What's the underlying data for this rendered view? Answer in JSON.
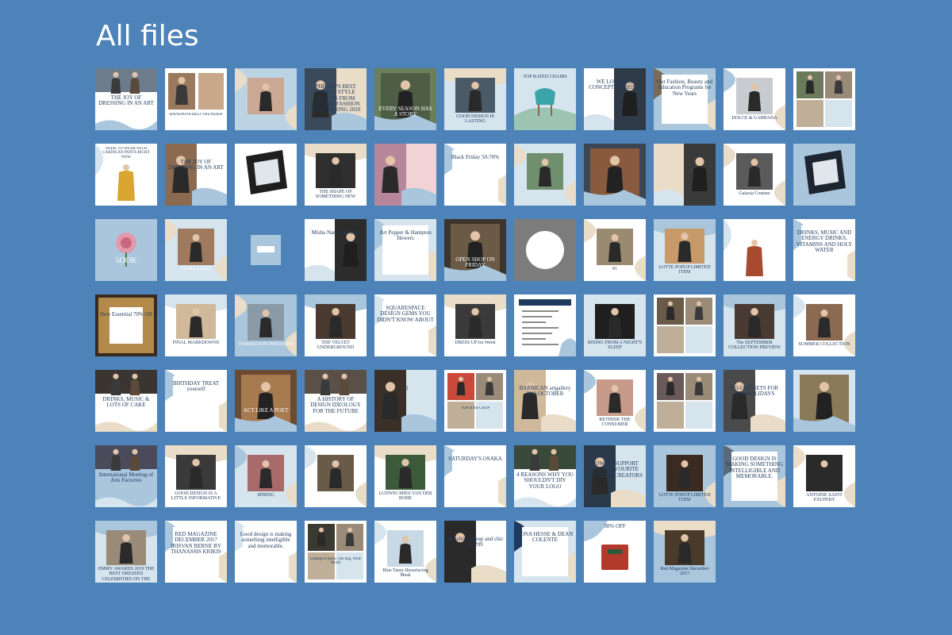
{
  "title": "All files",
  "colors": {
    "background": "#4d83b9",
    "navy": "#1f3a5c",
    "light_blue": "#a9c6dd",
    "pale_blue": "#d6e4ee",
    "beige": "#e9ddc8",
    "brown": "#8a6a4f",
    "gray": "#8c8c8c",
    "white": "#ffffff"
  },
  "tiles": [
    {
      "text": "THE JOY OF DRESSING IN AN ART",
      "bg": "#ffffff",
      "photo": "#6d7c8c",
      "layout": "top",
      "color": "#1f3a5c"
    },
    {
      "text": "BANDANA RED THUNDER",
      "bg": "#ffffff",
      "photo": "#9a7a5e",
      "layout": "split",
      "color": "#1f3a5c"
    },
    {
      "text": "",
      "bg": "#bcd3e4",
      "photo": "#caa893",
      "layout": "center",
      "color": "#1f3a5c"
    },
    {
      "text": "PHILOSPS BEST STREET STYLE PHOTOS FROM LONDON FASHION WEEK SPRING 2020",
      "bg": "#e9ddc8",
      "photo": "#3a4a5a",
      "layout": "left",
      "color": "#1f3a5c"
    },
    {
      "text": "EVERY SEASON HAS A STORY",
      "bg": "#6b7f5a",
      "photo": "#4e5e44",
      "layout": "full",
      "color": "#ffffff"
    },
    {
      "text": "GOOD DESIGN IS LASTING",
      "bg": "#d6e4ee",
      "photo": "#4a5a66",
      "layout": "bottom",
      "color": "#1f3a5c"
    },
    {
      "text": "TOP RATED CHAIRS",
      "bg": "#d6e4ee",
      "photo": "#3ba4a8",
      "layout": "chair",
      "color": "#1f3a5c"
    },
    {
      "text": "WE LOVE THE CONCEPT OF BEING",
      "bg": "#ffffff",
      "photo": "#2e3a46",
      "layout": "right",
      "color": "#1f3a5c"
    },
    {
      "text": "Our Fashion, Beauty and Education Programs for New Years",
      "bg": "#a9c6dd",
      "photo": "#7b6a58",
      "layout": "text",
      "color": "#1f3a5c"
    },
    {
      "text": "DOLCE & GABBANA",
      "bg": "#ffffff",
      "photo": "#c8ccd0",
      "layout": "center",
      "color": "#1f3a5c"
    },
    {
      "text": "",
      "bg": "#ffffff",
      "photo": "#6a7a5a",
      "layout": "grid",
      "color": "#1f3a5c"
    },
    {
      "text": "WHAT TO WEAR WITH CARDIGAN PANTS RIGHT NOW",
      "bg": "#ffffff",
      "photo": "#d8a530",
      "layout": "coat",
      "color": "#1f3a5c"
    },
    {
      "text": "THE JOY OF DRESSING IN AN ART",
      "bg": "#ffffff",
      "photo": "#8b6a50",
      "layout": "left",
      "color": "#1f3a5c"
    },
    {
      "text": "",
      "bg": "#ffffff",
      "photo": "#1e1e1e",
      "layout": "device",
      "color": "#1f3a5c"
    },
    {
      "text": "THE SHAPE OF SOMETHING NEW",
      "bg": "#ffffff",
      "photo": "#2f2f2f",
      "layout": "bottom",
      "color": "#1f3a5c"
    },
    {
      "text": "",
      "bg": "#f1d3d6",
      "photo": "#b7869a",
      "layout": "left",
      "color": "#1f3a5c"
    },
    {
      "text": "Black Friday 50-70%",
      "bg": "#ffffff",
      "photo": "#a9c6dd",
      "layout": "text",
      "color": "#1f3a5c"
    },
    {
      "text": "",
      "bg": "#d6e4ee",
      "photo": "#6f8f6e",
      "layout": "center",
      "color": "#1f3a5c"
    },
    {
      "text": "",
      "bg": "#3c4652",
      "photo": "#8a5a3e",
      "layout": "full",
      "color": "#ffffff"
    },
    {
      "text": "",
      "bg": "#e9ddc8",
      "photo": "#3a3a3a",
      "layout": "right",
      "color": "#1f3a5c"
    },
    {
      "text": "Galaxia Couture",
      "bg": "#ffffff",
      "photo": "#5a5a5a",
      "layout": "center",
      "color": "#1f3a5c"
    },
    {
      "text": "",
      "bg": "#a9c6dd",
      "photo": "#1d2530",
      "layout": "device",
      "color": "#1f3a5c"
    },
    {
      "text": "5OOK",
      "bg": "#a9c6dd",
      "photo": "#e29aac",
      "layout": "rose",
      "color": "#ffffff"
    },
    {
      "text": "ULTRA LIGHT",
      "bg": "#d6e4ee",
      "photo": "#a07a5e",
      "layout": "center",
      "color": "#ffffff"
    },
    {
      "text": "",
      "bg": "transparent",
      "photo": "#a9c6dd",
      "layout": "mini",
      "color": "#1f3a5c"
    },
    {
      "text": "Misha Nanov & Aldo",
      "bg": "#ffffff",
      "photo": "#2c2c2c",
      "layout": "right",
      "color": "#1f3a5c"
    },
    {
      "text": "Art Pepper & Hampton Hewers",
      "bg": "#d6e4ee",
      "photo": "#a9c6dd",
      "layout": "text",
      "color": "#1f3a5c"
    },
    {
      "text": "OPEN SHOP ON FRIDAY",
      "bg": "#3d352b",
      "photo": "#6a5a46",
      "layout": "full",
      "color": "#ffffff"
    },
    {
      "text": "",
      "bg": "#bdbdbd",
      "photo": "#7c7c7c",
      "layout": "circle",
      "color": "#1f3a5c"
    },
    {
      "text": "#1",
      "bg": "#ffffff",
      "photo": "#9a8a70",
      "layout": "center",
      "color": "#1f3a5c"
    },
    {
      "text": "LOTTE POPUP LIMITED ITEM",
      "bg": "#d6e4ee",
      "photo": "#c89a6a",
      "layout": "bottom",
      "color": "#1f3a5c"
    },
    {
      "text": "",
      "bg": "#ffffff",
      "photo": "#a84a30",
      "layout": "coat",
      "color": "#1f3a5c"
    },
    {
      "text": "DRINKS, MUSIC AND ENERGY DRINKS, VITAMINS AND HOLY WATER",
      "bg": "#ffffff",
      "photo": "#a9c6dd",
      "layout": "text",
      "color": "#1f3a5c"
    },
    {
      "text": "New Essential 70% Off",
      "bg": "#3a2a1c",
      "photo": "#b38a4a",
      "layout": "sale",
      "color": "#1f3a5c"
    },
    {
      "text": "FINAL MARKDOWNS",
      "bg": "#ffffff",
      "photo": "#d0b89a",
      "layout": "bottom",
      "color": "#1f3a5c"
    },
    {
      "text": "INSPIRATION IMITATION",
      "bg": "#a9c6dd",
      "photo": "#8a9aa6",
      "layout": "center",
      "color": "#ffffff"
    },
    {
      "text": "THE VELVET UNDERGROUND",
      "bg": "#ffffff",
      "photo": "#4a3a30",
      "layout": "bottom",
      "color": "#1f3a5c"
    },
    {
      "text": "SQUARESPACE DESIGN GEMS YOU DIDN'T KNOW ABOUT",
      "bg": "#ffffff",
      "photo": "#d6e4ee",
      "layout": "text",
      "color": "#1f3a5c"
    },
    {
      "text": "DRESS UP for Week",
      "bg": "#ffffff",
      "photo": "#3a3a3a",
      "layout": "bottom",
      "color": "#1f3a5c"
    },
    {
      "text": "",
      "bg": "#ffffff",
      "photo": "#1f3a5c",
      "layout": "list",
      "color": "#1f3a5c"
    },
    {
      "text": "RISING FROM A NIGHT'S SLEEP",
      "bg": "#d6e4ee",
      "photo": "#1f1f1f",
      "layout": "bottom",
      "color": "#1f3a5c"
    },
    {
      "text": "",
      "bg": "#ffffff",
      "photo": "#6a5a48",
      "layout": "grid",
      "color": "#1f3a5c"
    },
    {
      "text": "The SEPTEMBER COLLECTION PREVIEW",
      "bg": "#d6e4ee",
      "photo": "#4a3a34",
      "layout": "bottom",
      "color": "#1f3a5c"
    },
    {
      "text": "SUMMER COLLECTION",
      "bg": "#ffffff",
      "photo": "#8a6a50",
      "layout": "center",
      "color": "#1f3a5c"
    },
    {
      "text": "DRINKS, MUSIC & LOTS OF CAKE",
      "bg": "#ffffff",
      "photo": "#3a3530",
      "layout": "top",
      "color": "#1f3a5c"
    },
    {
      "text": "BIRTHDAY TREAT yourself",
      "bg": "#ffffff",
      "photo": "#a9c6dd",
      "layout": "text",
      "color": "#1f3a5c"
    },
    {
      "text": "ACT LIKE A POET",
      "bg": "#6a4a30",
      "photo": "#a87a50",
      "layout": "full",
      "color": "#ffffff"
    },
    {
      "text": "A HISTORY OF DESIGN IDEOLOGY FOR THE FUTURE",
      "bg": "#ffffff",
      "photo": "#5a5048",
      "layout": "top",
      "color": "#1f3a5c"
    },
    {
      "text": "12",
      "bg": "#d6e4ee",
      "photo": "#3a3028",
      "layout": "left",
      "color": "#1f3a5c"
    },
    {
      "text": "TOP of the CROP",
      "bg": "#ffffff",
      "photo": "#c94a3a",
      "layout": "grid",
      "color": "#1f3a5c"
    },
    {
      "text": "BARBICAN artgallery 20th OCTOBER",
      "bg": "#ffffff",
      "photo": "#d0b89a",
      "layout": "left",
      "color": "#1f3a5c"
    },
    {
      "text": "RETHINK THE CONSUMER",
      "bg": "#ffffff",
      "photo": "#c89a8a",
      "layout": "center",
      "color": "#1f3a5c"
    },
    {
      "text": "",
      "bg": "#ffffff",
      "photo": "#6a5a5a",
      "layout": "grid",
      "color": "#1f3a5c"
    },
    {
      "text": "CO-ORD SETS FOR THE HOLIDAYS",
      "bg": "#ffffff",
      "photo": "#4a4a4a",
      "layout": "left",
      "color": "#1f3a5c"
    },
    {
      "text": "",
      "bg": "#d6e4ee",
      "photo": "#8a7a5a",
      "layout": "full",
      "color": "#1f3a5c"
    },
    {
      "text": "International Meeting of Arts Factories",
      "bg": "#a9c6dd",
      "photo": "#4a4a5a",
      "layout": "top",
      "color": "#1f3a5c"
    },
    {
      "text": "GOOD DESIGN IS A LITTLE INFORMATIVE",
      "bg": "#ffffff",
      "photo": "#3a3a3a",
      "layout": "bottom",
      "color": "#1f3a5c"
    },
    {
      "text": "SPRING",
      "bg": "#d6e4ee",
      "photo": "#a86a6a",
      "layout": "center",
      "color": "#1f3a5c"
    },
    {
      "text": "",
      "bg": "#ffffff",
      "photo": "#6a5a48",
      "layout": "center",
      "color": "#1f3a5c"
    },
    {
      "text": "LUDWIG MIES VAN DER ROHE",
      "bg": "#ffffff",
      "photo": "#3a5a3a",
      "layout": "bottom",
      "color": "#1f3a5c"
    },
    {
      "text": "SATURDAY'S OSAKA",
      "bg": "#ffffff",
      "photo": "#a9c6dd",
      "layout": "text",
      "color": "#1f3a5c"
    },
    {
      "text": "4 REASONS WHY YOU SHOULDN'T DIY YOUR LOGO",
      "bg": "#ffffff",
      "photo": "#3a4a3a",
      "layout": "top",
      "color": "#1f3a5c"
    },
    {
      "text": "HOW TO SUPPORT YOUR FAVOURITE CONTENT CREATORS",
      "bg": "#d6e4ee",
      "photo": "#2a3a4a",
      "layout": "left",
      "color": "#1f3a5c"
    },
    {
      "text": "LOTTE POPUP LIMITED ITEM",
      "bg": "#a9c6dd",
      "photo": "#3a2a20",
      "layout": "center",
      "color": "#1f3a5c"
    },
    {
      "text": "GOOD DESIGN IS MAKING SOMETHING INTELLIGIBLE AND MEMORABLE.",
      "bg": "#a9c6dd",
      "photo": "#5a6a7a",
      "layout": "text",
      "color": "#1f3a5c"
    },
    {
      "text": "ANTOINE SAINT EXUPERY",
      "bg": "#ffffff",
      "photo": "#2a2a2a",
      "layout": "center",
      "color": "#1f3a5c"
    },
    {
      "text": "EMMY AWARDS 2019 THE BEST DRESSED CELEBRITIES ON THE RED CARPET",
      "bg": "#d6e4ee",
      "photo": "#9a8a78",
      "layout": "bottom",
      "color": "#1f3a5c"
    },
    {
      "text": "RED MAGAZINE DECEMBER 2017 IRISVAN BERNE BY THANASSIS KRIKIS",
      "bg": "#ffffff",
      "photo": "#a9c6dd",
      "layout": "text",
      "color": "#1f3a5c"
    },
    {
      "text": "Good design is making something intelligible and memorable.",
      "bg": "#ffffff",
      "photo": "#d6e4ee",
      "layout": "text",
      "color": "#1f3a5c"
    },
    {
      "text": "Getting to Know The Big, Wide World",
      "bg": "#ffffff",
      "photo": "#3a3a30",
      "layout": "grid",
      "color": "#1f3a5c"
    },
    {
      "text": "Blue Tansy Resurfacing Mask",
      "bg": "#ffffff",
      "photo": "#c8d8e4",
      "layout": "center",
      "color": "#1f3a5c"
    },
    {
      "text": "Moschino cheap and chic $1,299",
      "bg": "#ffffff",
      "photo": "#2a2a2a",
      "layout": "left",
      "color": "#1f3a5c"
    },
    {
      "text": "LONA HESSE & DEAN COLENTE",
      "bg": "#d6e4ee",
      "photo": "#1f3a5c",
      "layout": "text",
      "color": "#1f3a5c"
    },
    {
      "text": "30% OFF",
      "bg": "#ffffff",
      "photo": "#b33a2a",
      "layout": "bag",
      "color": "#1f3a5c"
    },
    {
      "text": "Red Magazine December 2017",
      "bg": "#a9c6dd",
      "photo": "#4a3a2a",
      "layout": "bottom",
      "color": "#1f3a5c"
    }
  ]
}
